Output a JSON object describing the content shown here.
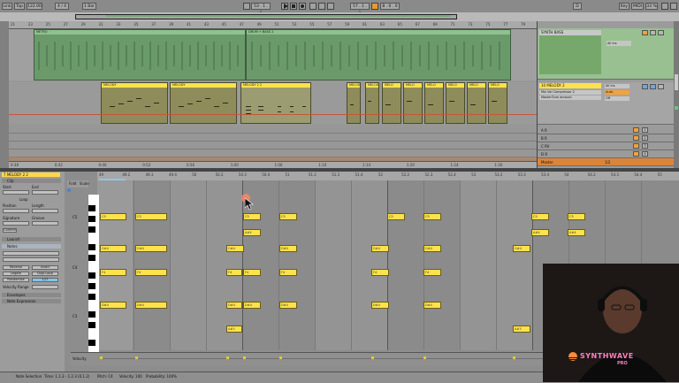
{
  "transport": {
    "link": "Link",
    "tap": "Tap",
    "tempo": "122.00",
    "signature": "4 / 4",
    "quantize": "1 Bar",
    "position": "53 . 1 . 1",
    "loop_start": "57 . 1 . 1",
    "loop_len": "8 . 0 . 0",
    "key": "Key",
    "midi": "MIDI",
    "cpu": "33 %",
    "d": "D"
  },
  "arrangement": {
    "top_ruler": [
      "21",
      "23",
      "25",
      "27",
      "29",
      "31",
      "33",
      "35",
      "37",
      "39",
      "41",
      "43",
      "45",
      "47",
      "49",
      "51",
      "53",
      "55",
      "57",
      "59",
      "61",
      "63",
      "65",
      "67",
      "69",
      "71",
      "73",
      "75",
      "77",
      "79"
    ],
    "bottom_ruler": [
      "0:38",
      "0:42",
      "0:46",
      "0:52",
      "0:56",
      "1:00",
      "1:06",
      "1:10",
      "1:14",
      "1:20",
      "1:24",
      "1:30"
    ],
    "green_clips": [
      {
        "label": "METRO"
      },
      {
        "label": "DRUM + BASS 2"
      }
    ],
    "melody_clips": [
      {
        "label": "MELODY"
      },
      {
        "label": "MELODY"
      },
      {
        "label": "MELODY 2 2"
      },
      {
        "label": "MELODY 2"
      },
      {
        "label": "MELODY 2"
      },
      {
        "label": "MELO"
      },
      {
        "label": "MELO"
      },
      {
        "label": "MELO"
      },
      {
        "label": "MELO"
      },
      {
        "label": "MELO"
      },
      {
        "label": "MELO"
      }
    ]
  },
  "tracks": {
    "row1_name": "SYNTH BASS",
    "row2_name": "10 MELODY 2",
    "row2_sub1": "Mix Vol Compressor 2",
    "row2_sub2": "MasterTune amount",
    "returns": [
      {
        "label": "A R",
        "num": "1"
      },
      {
        "label": "B R",
        "num": "2"
      },
      {
        "label": "C RV",
        "num": "3"
      },
      {
        "label": "D R",
        "num": "4"
      }
    ],
    "master": "Master",
    "master_out": "1/2",
    "in_label": "All Ins",
    "auto_label": "Auto",
    "off_label": "Off"
  },
  "clipview": {
    "title": "7 MELODY 2 2",
    "clip_label": "Clip",
    "start": "Start",
    "end": "End",
    "loop": "Loop",
    "position": "Position",
    "length": "Length",
    "signature": "Signature",
    "groove": "Groove",
    "commit": "Commit",
    "launch": "Launch",
    "notes": "Notes",
    "reverse": "Reverse",
    "invert": "Invert",
    "legato": "Legato",
    "dupl_loop": "Dupl.Loop",
    "randomize": "Randomize",
    "rand_val": "127",
    "velocity_range": "Velocity Range",
    "envelopes": "Envelopes",
    "note_expression": "Note Expression"
  },
  "pianoroll": {
    "ruler": [
      "49",
      "49.2",
      "49.3",
      "49.4",
      "50",
      "50.2",
      "50.3",
      "50.4",
      "51",
      "51.2",
      "51.3",
      "51.4",
      "52",
      "52.2",
      "52.3",
      "52.4",
      "53",
      "53.2",
      "53.3",
      "53.4",
      "54",
      "54.2",
      "54.3",
      "54.4",
      "55"
    ],
    "fold": "Fold",
    "scale": "Scale",
    "key_labels": [
      "C5",
      "C4",
      "C3"
    ],
    "velocity_label": "Velocity",
    "notes": [
      {
        "label": "C5"
      },
      {
        "label": "C5"
      },
      {
        "label": "C5"
      },
      {
        "label": "C5"
      },
      {
        "label": "C5"
      },
      {
        "label": "C5"
      },
      {
        "label": "C5"
      },
      {
        "label": "C5"
      },
      {
        "label": "A#4"
      },
      {
        "label": "A#4"
      },
      {
        "label": "A#4"
      },
      {
        "label": "G#4"
      },
      {
        "label": "G#4"
      },
      {
        "label": "G#4"
      },
      {
        "label": "G#4"
      },
      {
        "label": "G#4"
      },
      {
        "label": "G#4"
      },
      {
        "label": "G#4"
      },
      {
        "label": "F4"
      },
      {
        "label": "F4"
      },
      {
        "label": "F4"
      },
      {
        "label": "F4"
      },
      {
        "label": "F4"
      },
      {
        "label": "F4"
      },
      {
        "label": "F4"
      },
      {
        "label": "D#4"
      },
      {
        "label": "D#4"
      },
      {
        "label": "D#4"
      },
      {
        "label": "D#4"
      },
      {
        "label": "D#4"
      },
      {
        "label": "D#4"
      },
      {
        "label": "D#4"
      },
      {
        "label": "A#3"
      },
      {
        "label": "A#3"
      }
    ]
  },
  "status": {
    "left": "Note Selection",
    "time": "Time: 1.1.3 - 1.2.3 (0.1.2)",
    "pitch": "Pitch: C4",
    "velocity": "Velocity: 100",
    "probability": "Probability: 100%"
  },
  "brand": {
    "line1": "SYNTHWAVE",
    "line2": "PRO"
  },
  "colors": {
    "clip_yellow": "#fde24c",
    "clip_green": "#6a9a6a",
    "accent_orange": "#f4a23a",
    "logo_pink": "#ff4fa3"
  }
}
